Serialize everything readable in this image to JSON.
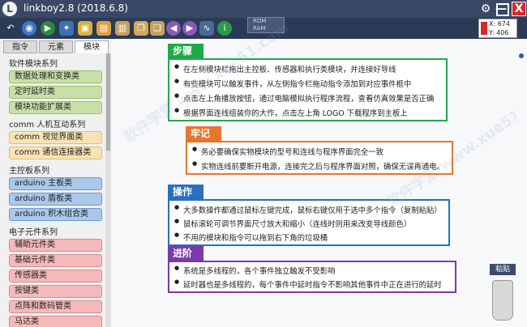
{
  "title": "linkboy2.8 (2018.6.8)",
  "rom_ram": [
    "ROM",
    "RAM"
  ],
  "window": {
    "minimize": "—",
    "close": "X"
  },
  "coords": {
    "x": "X: 674",
    "y": "Y: 406"
  },
  "tabs": [
    "指令",
    "元素",
    "模块"
  ],
  "sidebar": {
    "categories": [
      {
        "label": "软件模块系列",
        "items": [
          "数据处理和变换类",
          "定时延时类",
          "模块功能扩展类"
        ]
      },
      {
        "label": "comm 人机互动系列",
        "items": [
          "comm 视觉界面类",
          "comm 通信连接器类"
        ]
      },
      {
        "label": "主控板系列",
        "items": [
          "arduino 主板类",
          "arduino 盾板类",
          "arduino 积木组合类"
        ]
      },
      {
        "label": "电子元件系列",
        "items": [
          "辅助元件类",
          "基础元件类",
          "传感器类",
          "按键类",
          "点阵和数码管类",
          "马达类"
        ]
      }
    ]
  },
  "sections": [
    {
      "title": "步骤",
      "color": "#1faa4a",
      "lines": [
        "在左侧模块栏拖出主控板、传感器和执行类模块，并连接好导线",
        "有些模块可以触发事件，从左侧指令栏拖动指令添加到对应事件框中",
        "点击左上角播放按钮，通过电脑模拟执行程序流程，查看仿真效果是否正确",
        "根据界面连线组装你的大作，点击左上角 LOGO 下载程序到主板上"
      ]
    },
    {
      "title": "牢记",
      "color": "#e8762a",
      "lines": [
        "务必要确保实物模块的型号和连线与程序界面完全一致",
        "实物连线前要断开电源，连接完之后与程序界面对照，确保无误再通电。"
      ]
    },
    {
      "title": "操作",
      "color": "#2a6fc0",
      "lines": [
        "大多数操作都通过鼠标左键完成，鼠标右键仅用于选中多个指令（复制粘贴）",
        "鼠标滚轮可调节界面尺寸放大和缩小（连线时则用来改变导线颜色）",
        "不用的模块和指令可以拖到右下角的垃圾桶"
      ]
    },
    {
      "title": "进阶",
      "color": "#7a3aa8",
      "lines": [
        "系统是多线程的，各个事件独立触发不受影响",
        "延时器也是多线程的，每个事件中延时指令不影响其他事件中正在进行的延时"
      ]
    }
  ],
  "trash_label": "粘贴",
  "watermark": "软件学堂 www.xue51.com"
}
